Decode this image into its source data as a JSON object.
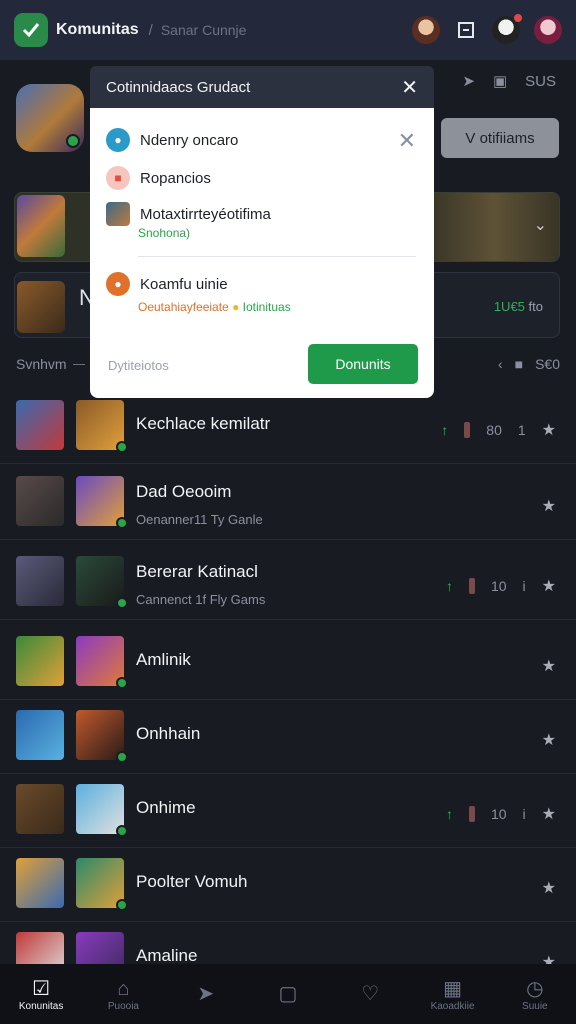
{
  "header": {
    "app_title": "Komunitas",
    "breadcrumb_sep": "/",
    "breadcrumb": "Sanar Cunnje",
    "logo_icon": "check-mark-icon",
    "accent": "#2a8a4a"
  },
  "background": {
    "right_tag": "SUS",
    "view_all_label": "V otifiiams",
    "card2": {
      "letter": "N",
      "meta_green": "1U€5",
      "meta_rest": "fto"
    },
    "section": {
      "label": "Svnhvm",
      "right_value": "S€0"
    }
  },
  "dialog": {
    "title": "Cotinnidaacs Grudact",
    "options": [
      {
        "label": "Ndenry oncaro",
        "icon": "water-drop-icon",
        "color": "#2a9ac8"
      },
      {
        "label": "Ropancios",
        "icon": "square-icon",
        "color": "#f08a7a"
      },
      {
        "label": "Motaxtirrteyéotifima",
        "icon": "game-art-icon",
        "color": "#3a6a8a"
      },
      {
        "label": "Koamfu uinie",
        "icon": "orange-circle-icon",
        "color": "#e0712a"
      }
    ],
    "green_sub": "Snohona)",
    "orange_sub": "Oeutahiayfeeiate",
    "orange_sub_tail": "Iotinituas",
    "footer_link": "Dytiteiotos",
    "primary_button": "Donunits"
  },
  "list": [
    {
      "title": "Kechlace kemilatr",
      "subtitle": "",
      "meta": [
        "80",
        "1"
      ]
    },
    {
      "title": "Dad Oeooim",
      "subtitle": "Oenanner11 Ty Ganle",
      "meta": []
    },
    {
      "title": "Bererar Katinacl",
      "subtitle": "Cannenct 1f Fly Gams",
      "meta": [
        "10",
        "i"
      ]
    },
    {
      "title": "Amlinik",
      "subtitle": "",
      "meta": []
    },
    {
      "title": "Onhhain",
      "subtitle": "",
      "meta": []
    },
    {
      "title": "Onhime",
      "subtitle": "",
      "meta": [
        "10",
        "i"
      ]
    },
    {
      "title": "Poolter Vomuh",
      "subtitle": "",
      "meta": []
    },
    {
      "title": "Amaline",
      "subtitle": "",
      "meta": []
    }
  ],
  "bottom_nav": [
    {
      "label": "Konunitas",
      "icon": "checkbox-icon",
      "active": true
    },
    {
      "label": "Puooia",
      "icon": "house-icon",
      "active": false
    },
    {
      "label": "",
      "icon": "plane-icon",
      "active": false
    },
    {
      "label": "",
      "icon": "square-icon",
      "active": false
    },
    {
      "label": "",
      "icon": "heart-icon",
      "active": false
    },
    {
      "label": "Kaoadkiie",
      "icon": "calendar-icon",
      "active": false
    },
    {
      "label": "Suuie",
      "icon": "clock-icon",
      "active": false
    }
  ]
}
